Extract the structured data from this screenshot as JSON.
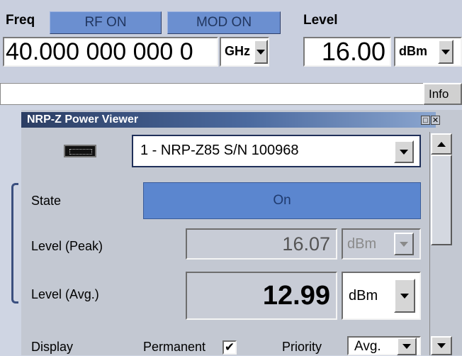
{
  "freq": {
    "label": "Freq",
    "rf_button": "RF ON",
    "mod_button": "MOD ON",
    "value": "40.000 000 000 0",
    "unit": "GHz"
  },
  "level": {
    "label": "Level",
    "value": "16.00",
    "unit": "dBm"
  },
  "info": {
    "message": "",
    "button": "Info"
  },
  "dialog": {
    "title": "NRP-Z Power Viewer",
    "sensor": "1 - NRP-Z85 S/N 100968",
    "state_label": "State",
    "state_value": "On",
    "peak_label": "Level (Peak)",
    "peak_value": "16.07",
    "peak_unit": "dBm",
    "avg_label": "Level (Avg.)",
    "avg_value": "12.99",
    "avg_unit": "dBm",
    "display_label": "Display",
    "permanent_label": "Permanent",
    "permanent_checked": true,
    "priority_label": "Priority",
    "priority_value": "Avg."
  },
  "colors": {
    "background": "#cfd5e3",
    "button_blue": "#6b8fd0",
    "titlebar": "#2c3e63"
  }
}
